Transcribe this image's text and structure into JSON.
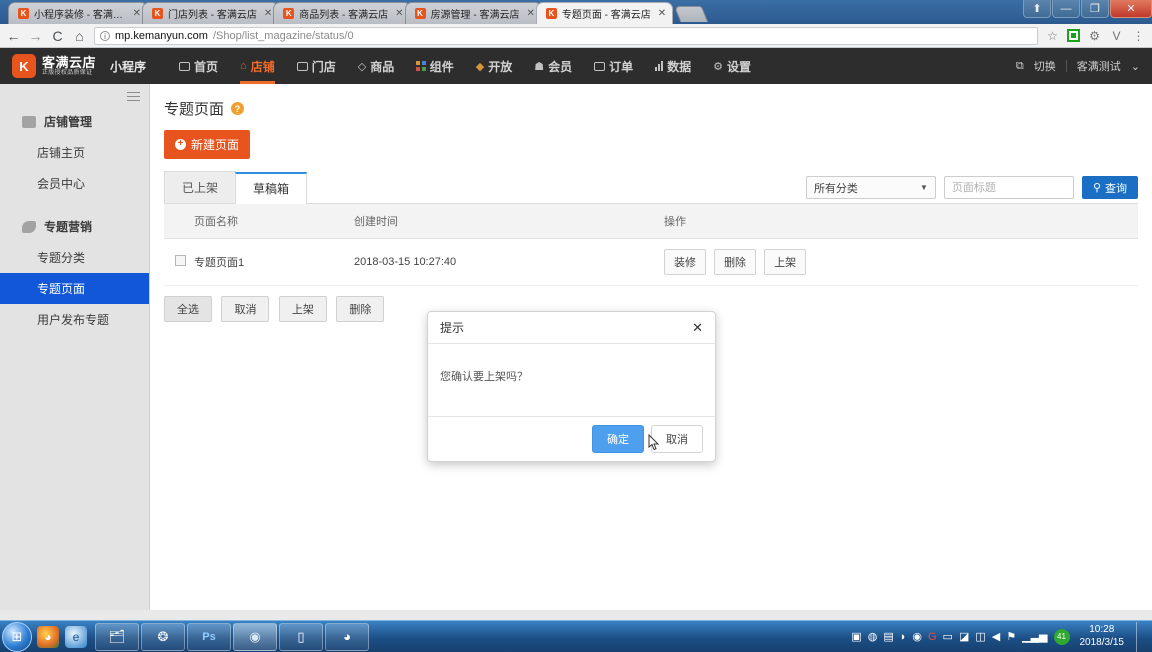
{
  "browser": {
    "tabs": [
      {
        "title": "小程序装修 - 客满云店",
        "favicon": "K",
        "active": false
      },
      {
        "title": "门店列表 - 客满云店",
        "favicon": "K",
        "active": false
      },
      {
        "title": "商品列表 - 客满云店",
        "favicon": "K",
        "active": false
      },
      {
        "title": "房源管理 - 客满云店",
        "favicon": "K",
        "active": false
      },
      {
        "title": "专题页面 - 客满云店",
        "favicon": "K",
        "active": true
      }
    ],
    "window_controls": {
      "restore": "⬆",
      "minimize": "—",
      "maximize": "❐",
      "close": "✕"
    },
    "nav": {
      "back": "←",
      "forward": "→",
      "reload": "C",
      "home": "⌂"
    },
    "url": {
      "info": "i",
      "host": "mp.kemanyun.com",
      "path": "/Shop/list_magazine/status/0"
    },
    "toolbar_icons": {
      "bookmark": "☆",
      "extension_gear": "⚙",
      "extension_v": "V",
      "menu": "⋮"
    }
  },
  "topnav": {
    "logo_main": "客满云店",
    "logo_sub": "正版授权品质保证",
    "logo_mark": "K",
    "product_tag": "小程序",
    "items": [
      {
        "label": "首页",
        "icon": "screen-icon",
        "active": false
      },
      {
        "label": "店铺",
        "icon": "home-icon",
        "active": true
      },
      {
        "label": "门店",
        "icon": "store-icon",
        "active": false
      },
      {
        "label": "商品",
        "icon": "tag-icon",
        "active": false
      },
      {
        "label": "组件",
        "icon": "grid-icon",
        "active": false
      },
      {
        "label": "开放",
        "icon": "cube-icon",
        "active": false
      },
      {
        "label": "会员",
        "icon": "user-icon",
        "active": false
      },
      {
        "label": "订单",
        "icon": "list-icon",
        "active": false
      },
      {
        "label": "数据",
        "icon": "chart-icon",
        "active": false
      },
      {
        "label": "设置",
        "icon": "gear-icon",
        "active": false
      }
    ],
    "switch_label": "切换",
    "account_name": "客满测试",
    "account_caret": "⌄"
  },
  "sidebar": {
    "groups": [
      {
        "label": "店铺管理",
        "icon": "store-icon",
        "items": [
          {
            "label": "店铺主页",
            "active": false
          },
          {
            "label": "会员中心",
            "active": false
          }
        ]
      },
      {
        "label": "专题营销",
        "icon": "tag-icon",
        "items": [
          {
            "label": "专题分类",
            "active": false
          },
          {
            "label": "专题页面",
            "active": true
          },
          {
            "label": "用户发布专题",
            "active": false
          }
        ]
      }
    ]
  },
  "main": {
    "page_title": "专题页面",
    "help_icon": "?",
    "new_page_button": "新建页面",
    "tabs": [
      {
        "label": "已上架",
        "active": false
      },
      {
        "label": "草稿箱",
        "active": true
      }
    ],
    "filters": {
      "category_value": "所有分类",
      "title_placeholder": "页面标题",
      "title_value": "",
      "search_button": "查询",
      "search_icon": "search-icon"
    },
    "table": {
      "headers": [
        "",
        "页面名称",
        "创建时间",
        "操作"
      ],
      "rows": [
        {
          "checked": false,
          "name": "专题页面1",
          "created_at": "2018-03-15 10:27:40",
          "actions": [
            "装修",
            "删除",
            "上架"
          ]
        }
      ]
    },
    "bulk_actions": [
      "全选",
      "取消",
      "上架",
      "删除"
    ]
  },
  "modal": {
    "title": "提示",
    "close_icon": "✕",
    "message": "您确认要上架吗？",
    "confirm_label": "确定",
    "cancel_label": "取消"
  },
  "taskbar": {
    "start": "⊞",
    "quick_launch": [
      "media-icon",
      "edge-icon"
    ],
    "apps": [
      {
        "name": "explorer-icon",
        "glyph": "🗂",
        "active": false
      },
      {
        "name": "tree-app-icon",
        "glyph": "❂",
        "active": false
      },
      {
        "name": "photoshop-icon",
        "glyph": "Ps",
        "active": false
      },
      {
        "name": "chrome-icon",
        "glyph": "◉",
        "active": true
      },
      {
        "name": "device-app-icon",
        "glyph": "▯",
        "active": false
      },
      {
        "name": "obs-icon",
        "glyph": "◕",
        "active": false
      }
    ],
    "tray_icons": [
      "monitor-icon",
      "globe-icon",
      "security-icon",
      "cloud-icon",
      "update-icon",
      "g-icon",
      "text-icon",
      "pen-icon",
      "device-icon",
      "volume-icon",
      "flag-icon",
      "signal-icon"
    ],
    "tray_badge": "41",
    "time": "10:28",
    "date": "2018/3/15"
  },
  "colors": {
    "accent_orange": "#e8541e",
    "accent_blue": "#1257d8",
    "tab_active_blue": "#2d8fdd",
    "search_blue": "#1a6fc4",
    "modal_primary": "#4ea0ef"
  }
}
